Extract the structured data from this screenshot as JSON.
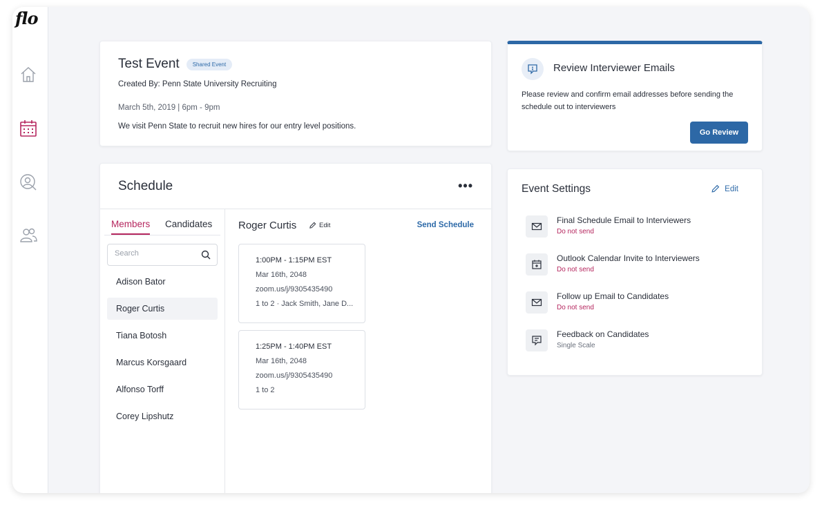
{
  "app": {
    "logo_text": "flo"
  },
  "sidebar": {
    "items": [
      {
        "name": "home",
        "icon": "home-icon",
        "active": false
      },
      {
        "name": "calendar",
        "icon": "calendar-icon",
        "active": true
      },
      {
        "name": "candidates",
        "icon": "user-search-icon",
        "active": false
      },
      {
        "name": "team",
        "icon": "users-icon",
        "active": false
      }
    ]
  },
  "event": {
    "title": "Test Event",
    "badge": "Shared Event",
    "created_by": "Created By: Penn State University Recruiting",
    "date": "March 5th, 2019 | 6pm - 9pm",
    "description": "We visit Penn State to recruit new hires for our entry level positions."
  },
  "schedule": {
    "title": "Schedule",
    "more_label": "•••",
    "tabs": [
      {
        "label": "Members",
        "active": true
      },
      {
        "label": "Candidates",
        "active": false
      }
    ],
    "search_placeholder": "Search",
    "members": [
      {
        "name": "Adison Bator",
        "selected": false
      },
      {
        "name": "Roger Curtis",
        "selected": true
      },
      {
        "name": "Tiana Botosh",
        "selected": false
      },
      {
        "name": "Marcus Korsgaard",
        "selected": false
      },
      {
        "name": "Alfonso Torff",
        "selected": false
      },
      {
        "name": "Corey Lipshutz",
        "selected": false
      }
    ],
    "detail": {
      "name": "Roger Curtis",
      "edit_label": "Edit",
      "send_label": "Send Schedule",
      "slots": [
        {
          "time": "1:00PM - 1:15PM EST",
          "date": "Mar 16th, 2048",
          "link": "zoom.us/j/9305435490",
          "attendees": "1 to 2 · Jack Smith, Jane D..."
        },
        {
          "time": "1:25PM - 1:40PM EST",
          "date": "Mar 16th, 2048",
          "link": "zoom.us/j/9305435490",
          "attendees": "1 to 2"
        }
      ]
    }
  },
  "review": {
    "title": "Review Interviewer Emails",
    "text": "Please review and confirm email addresses before sending the schedule out to interviewers",
    "button_label": "Go Review",
    "icon": "alert-message-icon"
  },
  "settings": {
    "title": "Event Settings",
    "edit_label": "Edit",
    "items": [
      {
        "label": "Final Schedule Email to Interviewers",
        "sub": "Do not send",
        "icon": "mail-icon"
      },
      {
        "label": "Outlook Calendar Invite to Interviewers",
        "sub": "Do not send",
        "icon": "calendar-plus-icon"
      },
      {
        "label": "Follow up Email to Candidates",
        "sub": "Do not send",
        "icon": "mail-icon"
      },
      {
        "label": "Feedback on Candidates",
        "sub": "Single Scale",
        "icon": "feedback-icon"
      }
    ]
  },
  "colors": {
    "accent_blue": "#2d68a6",
    "accent_pink": "#b5265e",
    "background": "#f4f5f8"
  }
}
